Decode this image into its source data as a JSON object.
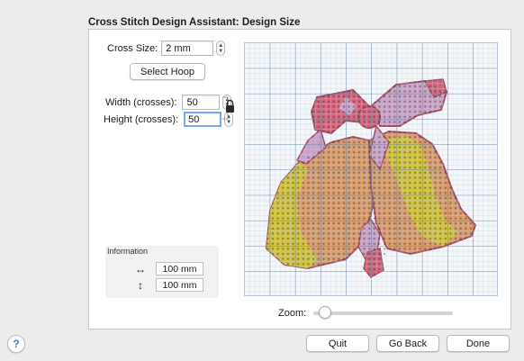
{
  "dialog": {
    "title": "Cross Stitch Design Assistant: Design Size"
  },
  "cross_size": {
    "label": "Cross Size:",
    "value": "2 mm"
  },
  "select_hoop": {
    "label": "Select Hoop"
  },
  "width": {
    "label": "Width (crosses):",
    "value": "50"
  },
  "height": {
    "label": "Height (crosses):",
    "value": "50"
  },
  "information": {
    "title": "Information",
    "width_value": "100 mm",
    "height_value": "100 mm",
    "width_icon": "horizontal-arrow-icon",
    "height_icon": "vertical-arrow-icon"
  },
  "preview": {
    "subject": "bells-with-bow-icon"
  },
  "zoom": {
    "label": "Zoom:"
  },
  "footer": {
    "quit": "Quit",
    "go_back": "Go Back",
    "done": "Done",
    "help": "?"
  },
  "colors": {
    "grid_major": "#6f8aa6",
    "grid_minor": "#c5d2de",
    "bell_yellow": "#cfc23a",
    "bell_orange": "#d79a68",
    "bow_pink": "#d4607a",
    "bow_lilac": "#c9a1c8",
    "outline": "#a24a5e",
    "accent": "#3a7be0"
  }
}
